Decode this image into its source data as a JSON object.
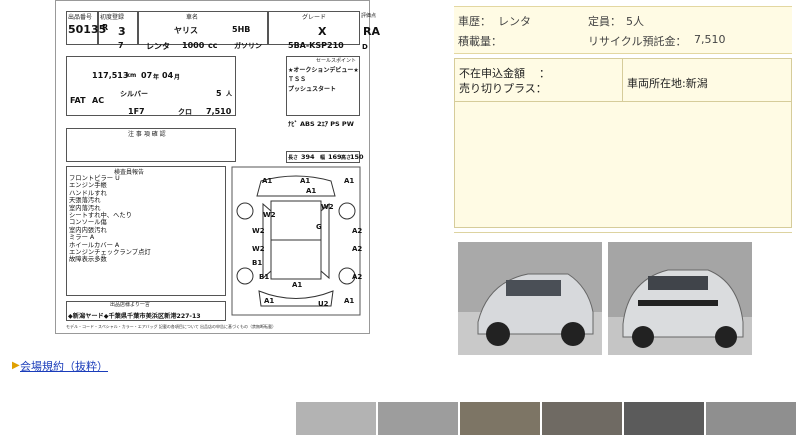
{
  "sheet": {
    "header_labels": {
      "lot": "出品番号",
      "year": "初度登録",
      "name": "車名",
      "model_code": "型式",
      "grade": "グレード",
      "score": "評価点",
      "prev_use": "前使用",
      "cc": "排気量",
      "fuel": "燃料",
      "full_model": "型式"
    },
    "lot_no": "50135",
    "era": "R",
    "year": "3",
    "month": "7",
    "car_name": "ヤリス",
    "body": "5HB",
    "grade": "X",
    "score": "RA",
    "use": "レンタ",
    "cc": "1000",
    "cc_unit": "cc",
    "fuel": "ガソリン",
    "model": "5BA-KSP210",
    "interior_score": "D",
    "exterior_score": "C",
    "mileage": "117,513",
    "mileage_unit": "km",
    "inspection": "07",
    "inspection_unit": "年",
    "inspection_month": "04",
    "inspection_month_unit": "月",
    "trans": "FAT",
    "ac": "AC",
    "color": "シルバー",
    "doors": "5",
    "seats_unit": "人",
    "color_code": "1F7",
    "interior_color": "クロ",
    "recycle": "7,510",
    "sales_points_title": "セールスポイント",
    "sales_points": [
      "★オークションデビュー★",
      "ＴＳＳ",
      "プッシュスタート"
    ],
    "equipment": "ﾅﾋﾞ  ABS  2ｴｱ  PS  PW",
    "notes_title": "注 事 項 確 認",
    "length_label": "長さ",
    "length": "394",
    "width_label": "幅",
    "width": "169",
    "height_label": "高さ",
    "height": "150",
    "inspector_title": "検査員報告",
    "inspector_notes": [
      "フロントピラー U",
      "エンジン手帳",
      "ハンドルすれ",
      "天張落汚れ",
      "室内落汚れ",
      "シートすれ中、へたり",
      "コンソール傷",
      "室内内張汚れ",
      "ミラー A",
      "ホイールカバー A",
      "エンジンチェックランプ点灯",
      "故障表示多数"
    ],
    "damage_marks": [
      "A1",
      "A1",
      "A1",
      "A1",
      "W2",
      "G",
      "W2",
      "W2",
      "A2",
      "W2",
      "B1",
      "A2",
      "B1",
      "A2",
      "A1",
      "U2",
      "A1",
      "A1"
    ],
    "footer_title": "出品店様より一言",
    "footer_text": "◆新潟ヤード◆千葉県千葉市美浜区新港227-13",
    "disclaimer": "モデル・コード・スペシャル・カラー・エアバッグ 記載の各項目について 出品店の申告に基づくもの（禁無断転載）"
  },
  "info": {
    "history_label": "車歴：",
    "history": "レンタ",
    "capacity_label": "定員：",
    "capacity": "5人",
    "load_label": "積載量：",
    "load": "",
    "recycle_label": "リサイクル預託金：",
    "recycle": "7,510"
  },
  "sale": {
    "line1": "不在申込金額",
    "line1_sep": "：",
    "line2": "売り切りプラス：",
    "location": "車両所在地:新潟"
  },
  "link_text": "会場規約（抜粋）",
  "colors": {
    "accent_bg": "#fffbe4",
    "border": "#d6cc9a",
    "link": "#1a3cba"
  },
  "icons": {
    "bullet": "arrow-bullet-icon"
  }
}
